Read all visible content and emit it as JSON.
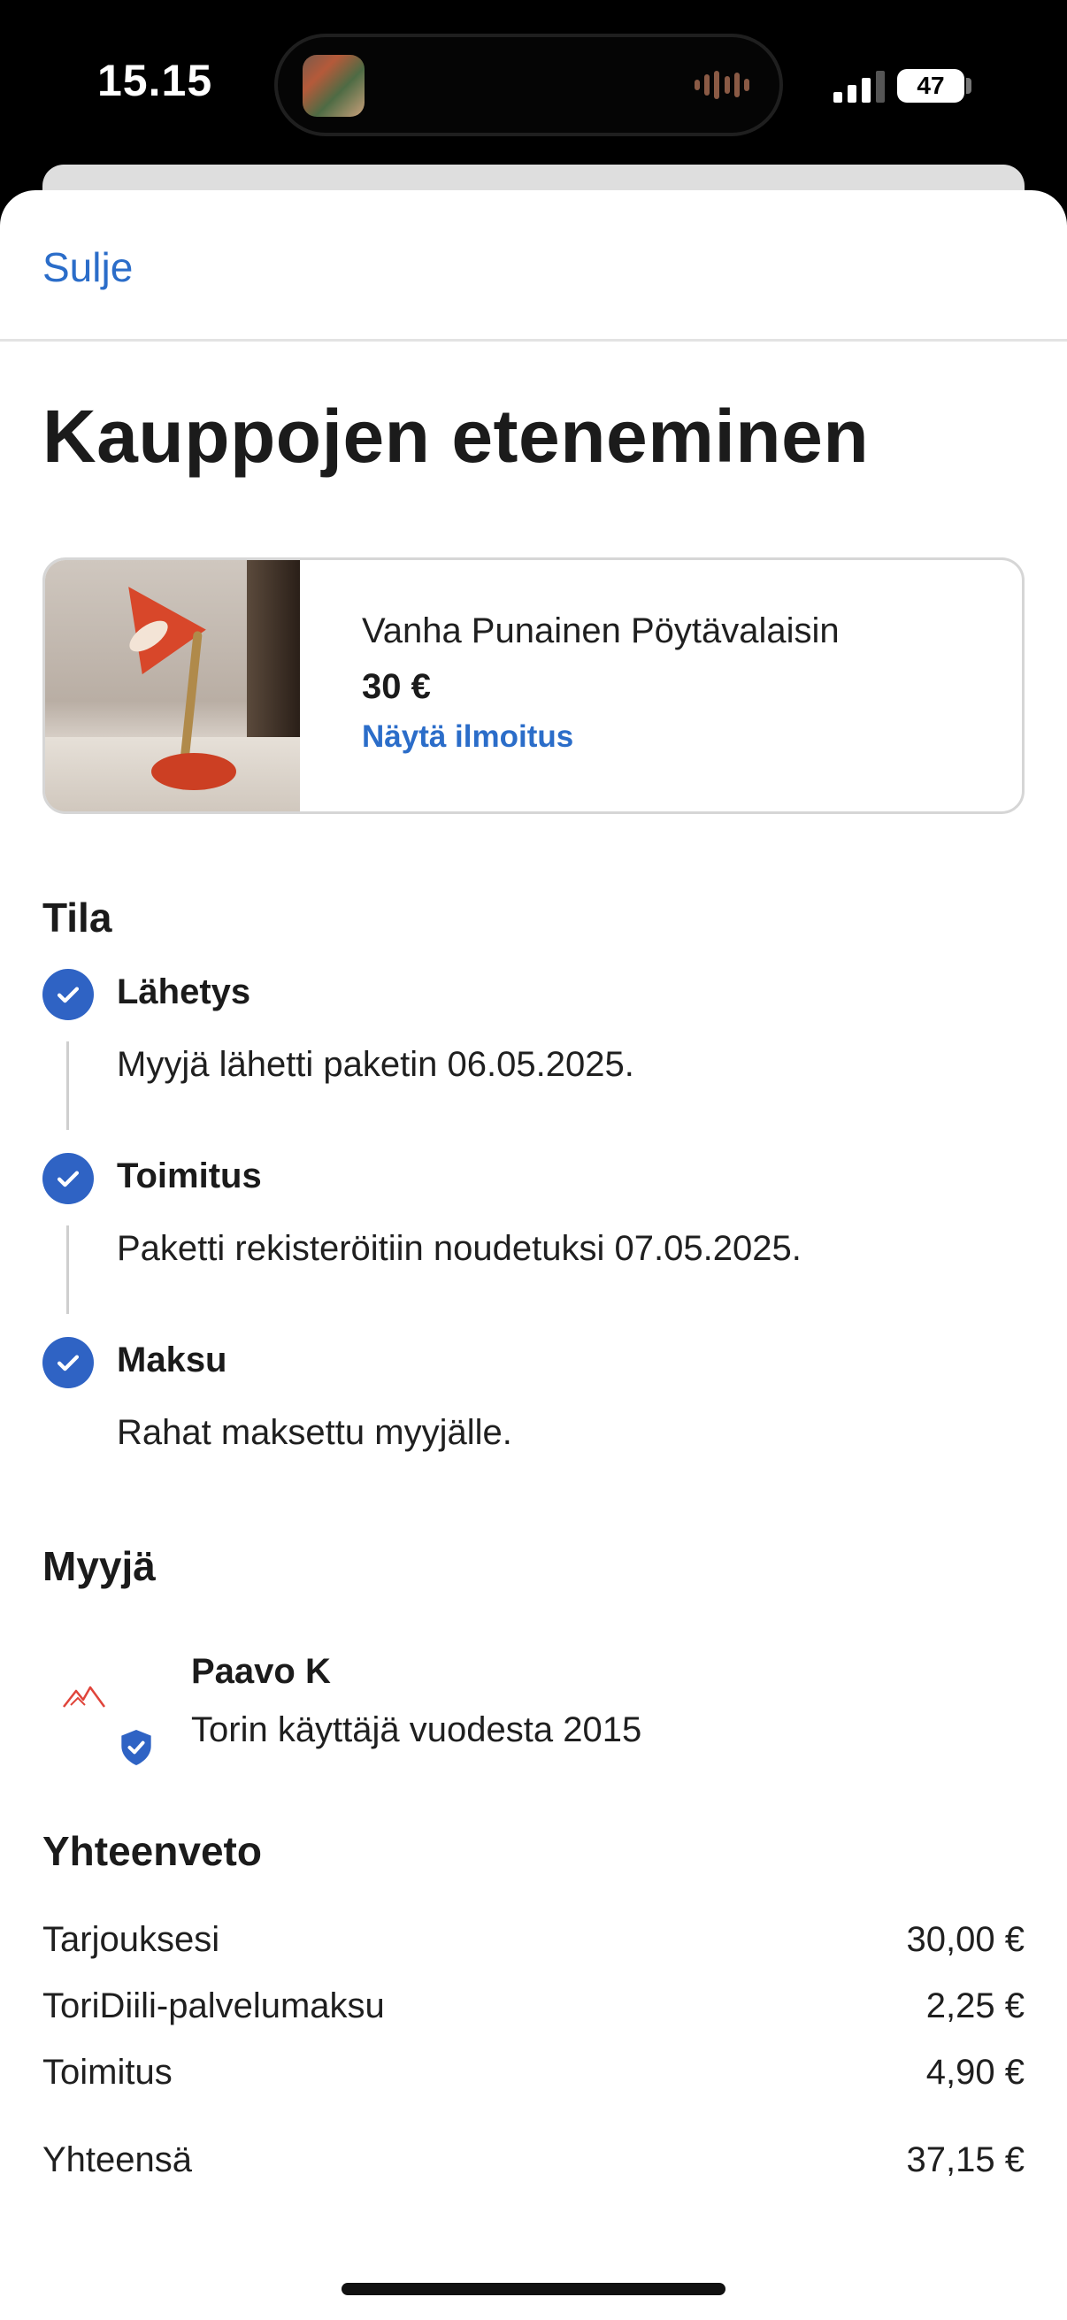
{
  "status_bar": {
    "time": "15.15",
    "battery": "47",
    "battery_level_percent": 47
  },
  "header": {
    "close_label": "Sulje"
  },
  "page": {
    "title": "Kauppojen eteneminen"
  },
  "item": {
    "title": "Vanha Punainen Pöytävalaisin",
    "price": "30 €",
    "link_label": "Näytä ilmoitus",
    "image_icon": "lamp-photo"
  },
  "status": {
    "heading": "Tila",
    "steps": [
      {
        "title": "Lähetys",
        "description": "Myyjä lähetti paketin 06.05.2025.",
        "completed": true
      },
      {
        "title": "Toimitus",
        "description": "Paketti rekisteröitiin noudetuksi 07.05.2025.",
        "completed": true
      },
      {
        "title": "Maksu",
        "description": "Rahat maksettu myyjälle.",
        "completed": true
      }
    ]
  },
  "seller": {
    "heading": "Myyjä",
    "name": "Paavo K",
    "member_since": "Torin käyttäjä vuodesta 2015",
    "verified": true
  },
  "summary": {
    "heading": "Yhteenveto",
    "rows": [
      {
        "label": "Tarjouksesi",
        "value": "30,00 €"
      },
      {
        "label": "ToriDiili-palvelumaksu",
        "value": "2,25 €"
      },
      {
        "label": "Toimitus",
        "value": "4,90 €"
      }
    ],
    "total": {
      "label": "Yhteensä",
      "value": "37,15 €"
    }
  },
  "colors": {
    "accent": "#2b6dc9",
    "check": "#2f63c4",
    "text": "#1b1b1b"
  }
}
